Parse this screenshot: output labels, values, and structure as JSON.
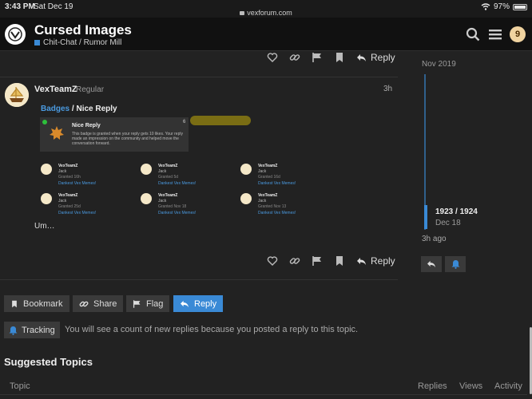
{
  "status_bar": {
    "time": "3:43 PM",
    "date": "Sat Dec 19",
    "url": "vexforum.com",
    "battery": "97%"
  },
  "header": {
    "title": "Cursed Images",
    "category": "Chit-Chat / Rumor Mill",
    "avatar_letter": "9"
  },
  "post_actions": {
    "reply_label": "Reply"
  },
  "post": {
    "username": "VexTeamZ",
    "role": "Regular",
    "time": "3h",
    "onebox_link": "Badges",
    "onebox_sep": " / ",
    "onebox_title": "Nice Reply",
    "badge_name": "Nice Reply",
    "badge_count": "6",
    "badge_desc": "This badge is granted when your reply gets 10 likes. Your reply made an impression on the community and helped move the conversation forward.",
    "body": "Um…"
  },
  "grants": [
    {
      "user": "VexTeamZ",
      "name": "Jack",
      "time": "Granted 16h",
      "topic": "Dankest Vex Memes!"
    },
    {
      "user": "VexTeamZ",
      "name": "Jack",
      "time": "Granted 5d",
      "topic": "Dankest Vex Memes!"
    },
    {
      "user": "VexTeamZ",
      "name": "Jack",
      "time": "Granted 16d",
      "topic": "Dankest Vex Memes!"
    },
    {
      "user": "VexTeamZ",
      "name": "Jack",
      "time": "Granted 25d",
      "topic": "Dankest Vex Memes!"
    },
    {
      "user": "VexTeamZ",
      "name": "Jack",
      "time": "Granted Nov 18",
      "topic": "Dankest Vex Memes!"
    },
    {
      "user": "VexTeamZ",
      "name": "Jack",
      "time": "Granted Nov 13",
      "topic": "Dankest Vex Memes!"
    }
  ],
  "timeline": {
    "start_date": "Nov 2019",
    "position": "1923 / 1924",
    "position_date": "Dec 18",
    "ago": "3h ago"
  },
  "footer_buttons": {
    "bookmark": "Bookmark",
    "share": "Share",
    "flag": "Flag",
    "reply": "Reply"
  },
  "tracking": {
    "label": "Tracking",
    "note": "You will see a count of new replies because you posted a reply to this topic."
  },
  "suggested": {
    "title": "Suggested Topics",
    "columns": [
      "Topic",
      "Replies",
      "Views",
      "Activity"
    ]
  },
  "colors": {
    "accent": "#3a8ad6",
    "background": "#222222",
    "header": "#111111",
    "button": "#3a3a3a"
  },
  "icons": [
    "search-icon",
    "menu-icon",
    "heart-icon",
    "link-icon",
    "flag-icon",
    "bookmark-icon",
    "reply-icon",
    "bell-icon",
    "lock-icon",
    "wifi-icon",
    "battery-icon"
  ]
}
